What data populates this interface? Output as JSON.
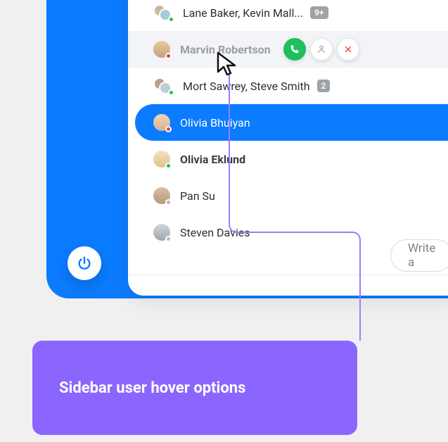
{
  "colors": {
    "accent_blue": "#0b7bff",
    "callout_purple": "#8a66ff",
    "call_green": "#1fbf5b",
    "close_red": "#ef4444"
  },
  "contacts": [
    {
      "name": "Lane Baker, Kevin Mall...",
      "bold": false,
      "group": true,
      "status": "online",
      "badge": "9+"
    },
    {
      "name": "Marvin Robertson",
      "bold": true,
      "group": false,
      "status": "busy",
      "hovered": true
    },
    {
      "name": "Mort Sawrey, Steve Smith",
      "bold": false,
      "group": true,
      "status": "online",
      "badge": "2"
    },
    {
      "name": "Olivia Bhuiyan",
      "bold": false,
      "group": false,
      "status": "busy",
      "selected": true
    },
    {
      "name": "Olivia Eklund",
      "bold": true,
      "group": false,
      "status": "online"
    },
    {
      "name": "Pan Su",
      "bold": false,
      "group": false,
      "status": "idle"
    },
    {
      "name": "Steven Davies",
      "bold": false,
      "group": false,
      "status": "idle"
    }
  ],
  "hover_actions": {
    "call": "call-icon",
    "profile": "person-icon",
    "close": "close-icon"
  },
  "power_button": "power-icon",
  "write_placeholder": "Write a",
  "callout_text": "Sidebar user hover options"
}
